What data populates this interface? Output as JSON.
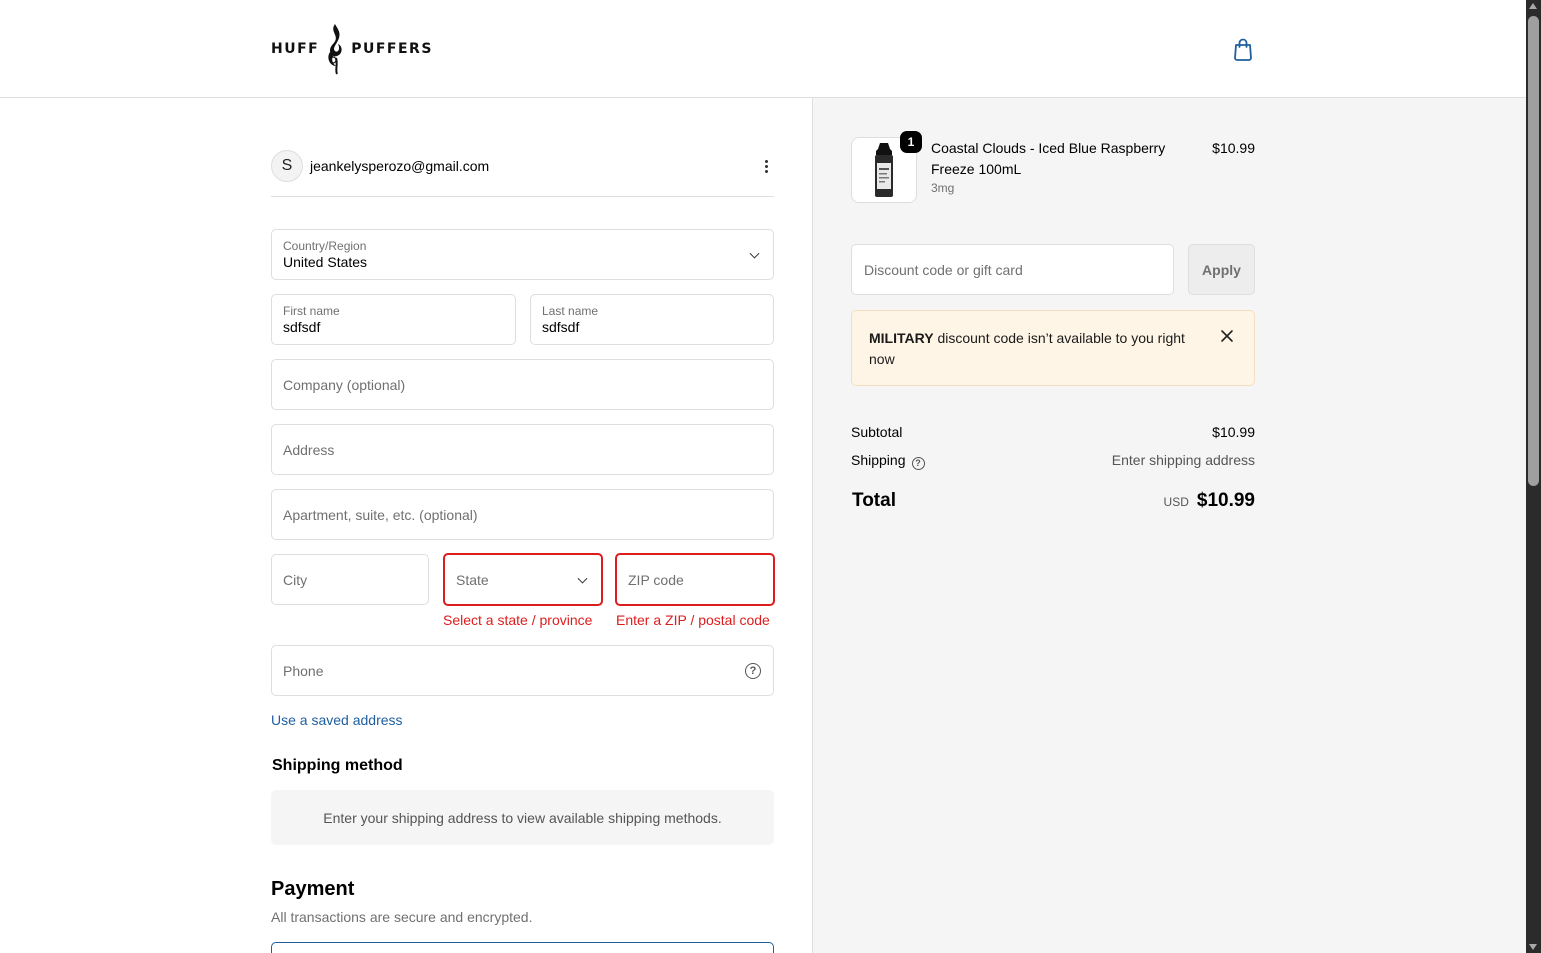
{
  "brand": {
    "logo_left": "HUFF",
    "logo_right": "PUFFERS"
  },
  "account": {
    "avatar_initial": "S",
    "email": "jeankelysperozo@gmail.com"
  },
  "form": {
    "country": {
      "label": "Country/Region",
      "value": "United States"
    },
    "first_name": {
      "label": "First name",
      "value": "sdfsdf"
    },
    "last_name": {
      "label": "Last name",
      "value": "sdfsdf"
    },
    "company": {
      "placeholder": "Company (optional)"
    },
    "address": {
      "placeholder": "Address"
    },
    "apartment": {
      "placeholder": "Apartment, suite, etc. (optional)"
    },
    "city": {
      "placeholder": "City"
    },
    "state": {
      "placeholder": "State",
      "error": "Select a state / province"
    },
    "zip": {
      "placeholder": "ZIP code",
      "error": "Enter a ZIP / postal code"
    },
    "phone": {
      "placeholder": "Phone"
    },
    "saved_address_link": "Use a saved address"
  },
  "shipping": {
    "title": "Shipping method",
    "message": "Enter your shipping address to view available shipping methods."
  },
  "payment": {
    "title": "Payment",
    "subtitle": "All transactions are secure and encrypted."
  },
  "summary": {
    "product": {
      "quantity": "1",
      "name": "Coastal Clouds - Iced Blue Raspberry Freeze 100mL",
      "variant": "3mg",
      "price": "$10.99"
    },
    "discount": {
      "placeholder": "Discount code or gift card",
      "apply_label": "Apply"
    },
    "notice": {
      "code": "MILITARY",
      "message": "discount code isn’t available to you right now"
    },
    "subtotal_label": "Subtotal",
    "subtotal_value": "$10.99",
    "shipping_label": "Shipping",
    "shipping_value": "Enter shipping address",
    "total_label": "Total",
    "currency": "USD",
    "total_value": "$10.99"
  },
  "colors": {
    "error": "#dd1d1d",
    "link": "#1f5fa0",
    "notice_bg": "#fef5e6",
    "panel_bg": "#f5f5f5"
  }
}
